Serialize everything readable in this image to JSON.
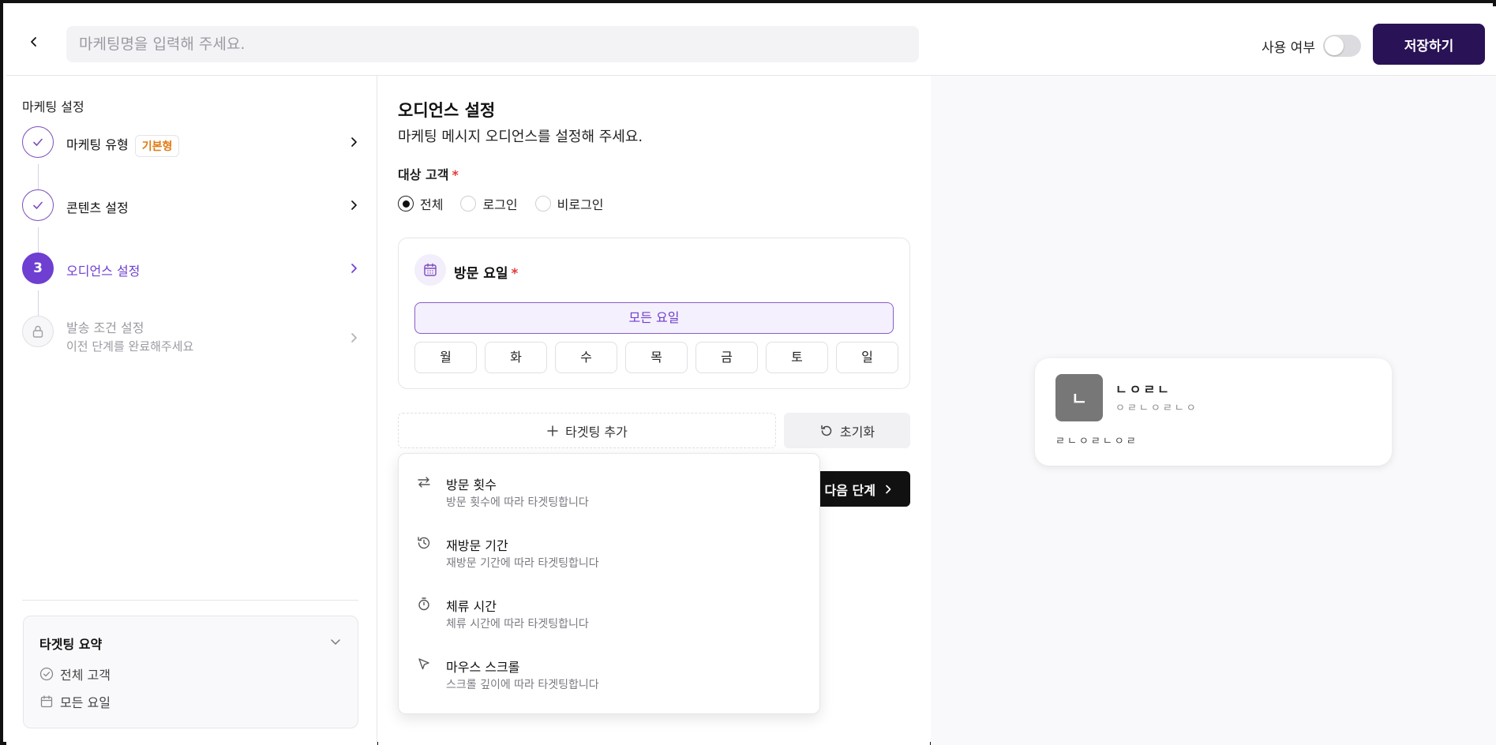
{
  "header": {
    "name_placeholder": "마케팅명을 입력해 주세요.",
    "use_label": "사용 여부",
    "use_enabled": false,
    "save_label": "저장하기"
  },
  "sidebar": {
    "title": "마케팅 설정",
    "steps": [
      {
        "label": "마케팅 유형",
        "badge": "기본형",
        "state": "done"
      },
      {
        "label": "콘텐츠 설정",
        "state": "done"
      },
      {
        "number": "3",
        "label": "오디언스 설정",
        "state": "active"
      },
      {
        "label": "발송 조건 설정",
        "sub": "이전 단계를 완료해주세요",
        "state": "locked"
      }
    ],
    "summary": {
      "title": "타겟팅 요약",
      "items": [
        "전체 고객",
        "모든 요일"
      ]
    }
  },
  "main": {
    "title": "오디언스 설정",
    "description": "마케팅 메시지 오디언스를 설정해 주세요.",
    "target_label": "대상 고객",
    "required_mark": "*",
    "radios": [
      {
        "label": "전체",
        "selected": true
      },
      {
        "label": "로그인",
        "selected": false
      },
      {
        "label": "비로그인",
        "selected": false
      }
    ],
    "day_card": {
      "title": "방문 요일",
      "all_days_label": "모든 요일",
      "days": [
        "월",
        "화",
        "수",
        "목",
        "금",
        "토",
        "일"
      ]
    },
    "add_target_label": "타겟팅 추가",
    "reset_label": "초기화",
    "next_label": "다음 단계",
    "dropdown": [
      {
        "icon": "repeat-icon",
        "label": "방문 횟수",
        "sub": "방문 횟수에 따라 타겟팅합니다"
      },
      {
        "icon": "history-icon",
        "label": "재방문 기간",
        "sub": "재방문 기간에 따라 타겟팅합니다"
      },
      {
        "icon": "timer-icon",
        "label": "체류 시간",
        "sub": "체류 시간에 따라 타겟팅합니다"
      },
      {
        "icon": "cursor-icon",
        "label": "마우스 스크롤",
        "sub": "스크롤 깊이에 따라 타겟팅합니다"
      }
    ]
  },
  "preview": {
    "avatar_text": "ㄴ",
    "name": "ㄴㅇㄹㄴ",
    "sub": "ㅇㄹㄴㅇㄹㄴㅇ",
    "body": "ㄹㄴㅇㄹㄴㅇㄹ"
  },
  "colors": {
    "accent": "#6e3fd0",
    "save_button": "#2a1257",
    "badge_text": "#e07b12",
    "required": "#e23b3b"
  }
}
